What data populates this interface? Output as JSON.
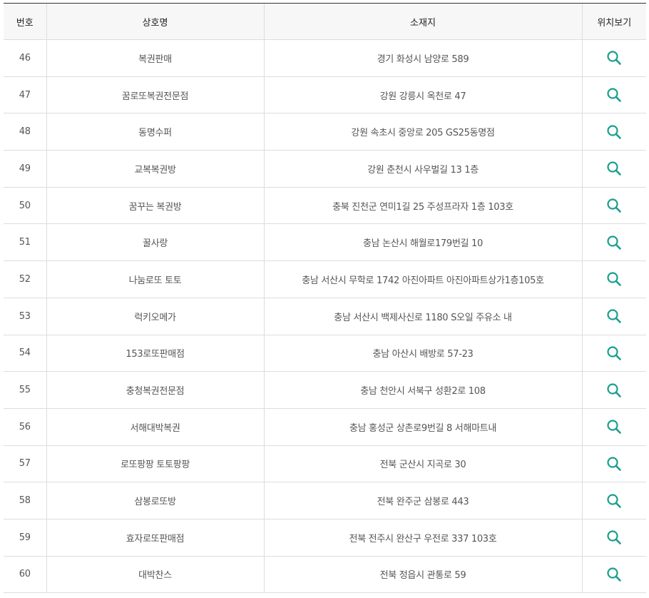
{
  "table": {
    "headers": {
      "number": "번호",
      "name": "상호명",
      "address": "소재지",
      "location": "위치보기"
    },
    "icon": "search-icon",
    "icon_color": "#1a9e8e",
    "rows": [
      {
        "number": "46",
        "name": "복권판매",
        "address": "경기 화성시 남양로 589"
      },
      {
        "number": "47",
        "name": "꿈로또복권전문점",
        "address": "강원 강릉시 옥천로 47"
      },
      {
        "number": "48",
        "name": "동명수퍼",
        "address": "강원 속초시 중앙로 205 GS25동명점"
      },
      {
        "number": "49",
        "name": "교복복권방",
        "address": "강원 춘천시 사우벌길 13 1층"
      },
      {
        "number": "50",
        "name": "꿈꾸는 복권방",
        "address": "충북 진천군 연미1길 25 주성프라자 1층 103호"
      },
      {
        "number": "51",
        "name": "꿀사랑",
        "address": "충남 논산시 해월로179번길 10"
      },
      {
        "number": "52",
        "name": "나눔로또 토토",
        "address": "충남 서산시 무학로 1742 아진아파트 아진아파트상가1층105호"
      },
      {
        "number": "53",
        "name": "럭키오메가",
        "address": "충남 서산시 백제사신로 1180 S오일 주유소 내"
      },
      {
        "number": "54",
        "name": "153로또판매점",
        "address": "충남 아산시 배방로 57-23"
      },
      {
        "number": "55",
        "name": "충청복권전문점",
        "address": "충남 천안시 서북구 성환2로 108"
      },
      {
        "number": "56",
        "name": "서해대박복권",
        "address": "충남 홍성군 상촌로9번길 8 서해마트내"
      },
      {
        "number": "57",
        "name": "로또팡팡 토토팡팡",
        "address": "전북 군산시 지곡로 30"
      },
      {
        "number": "58",
        "name": "삼봉로또방",
        "address": "전북 완주군 삼봉로 443"
      },
      {
        "number": "59",
        "name": "효자로또판매점",
        "address": "전북 전주시 완산구 우전로 337 103호"
      },
      {
        "number": "60",
        "name": "대박찬스",
        "address": "전북 정읍시 관통로 59"
      }
    ]
  }
}
